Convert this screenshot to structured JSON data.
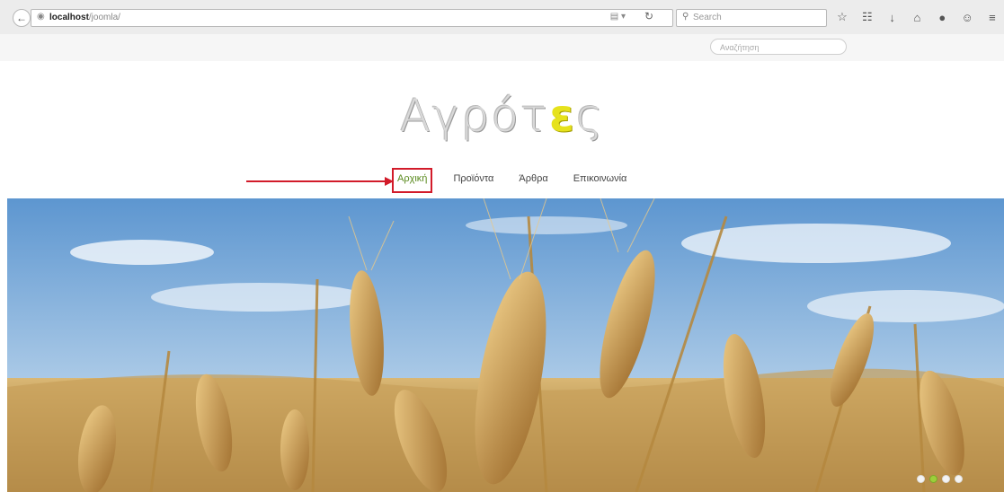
{
  "browser": {
    "url_host": "localhost",
    "url_path": "/joomla/",
    "search_placeholder": "Search",
    "icons": [
      "star-icon",
      "clipboard-icon",
      "download-icon",
      "home-icon",
      "chat-icon",
      "face-icon",
      "menu-icon"
    ]
  },
  "site": {
    "search_placeholder": "Αναζήτηση",
    "logo_main": "Αγρότ",
    "logo_highlight": "ε",
    "logo_end": "ς",
    "accent_color": "#e6e21c",
    "nav": [
      {
        "label": "Αρχική",
        "active": true
      },
      {
        "label": "Προϊόντα",
        "active": false
      },
      {
        "label": "Άρθρα",
        "active": false
      },
      {
        "label": "Επικοινωνία",
        "active": false
      }
    ]
  },
  "slider": {
    "slide_count": 4,
    "active_slide": 2
  }
}
